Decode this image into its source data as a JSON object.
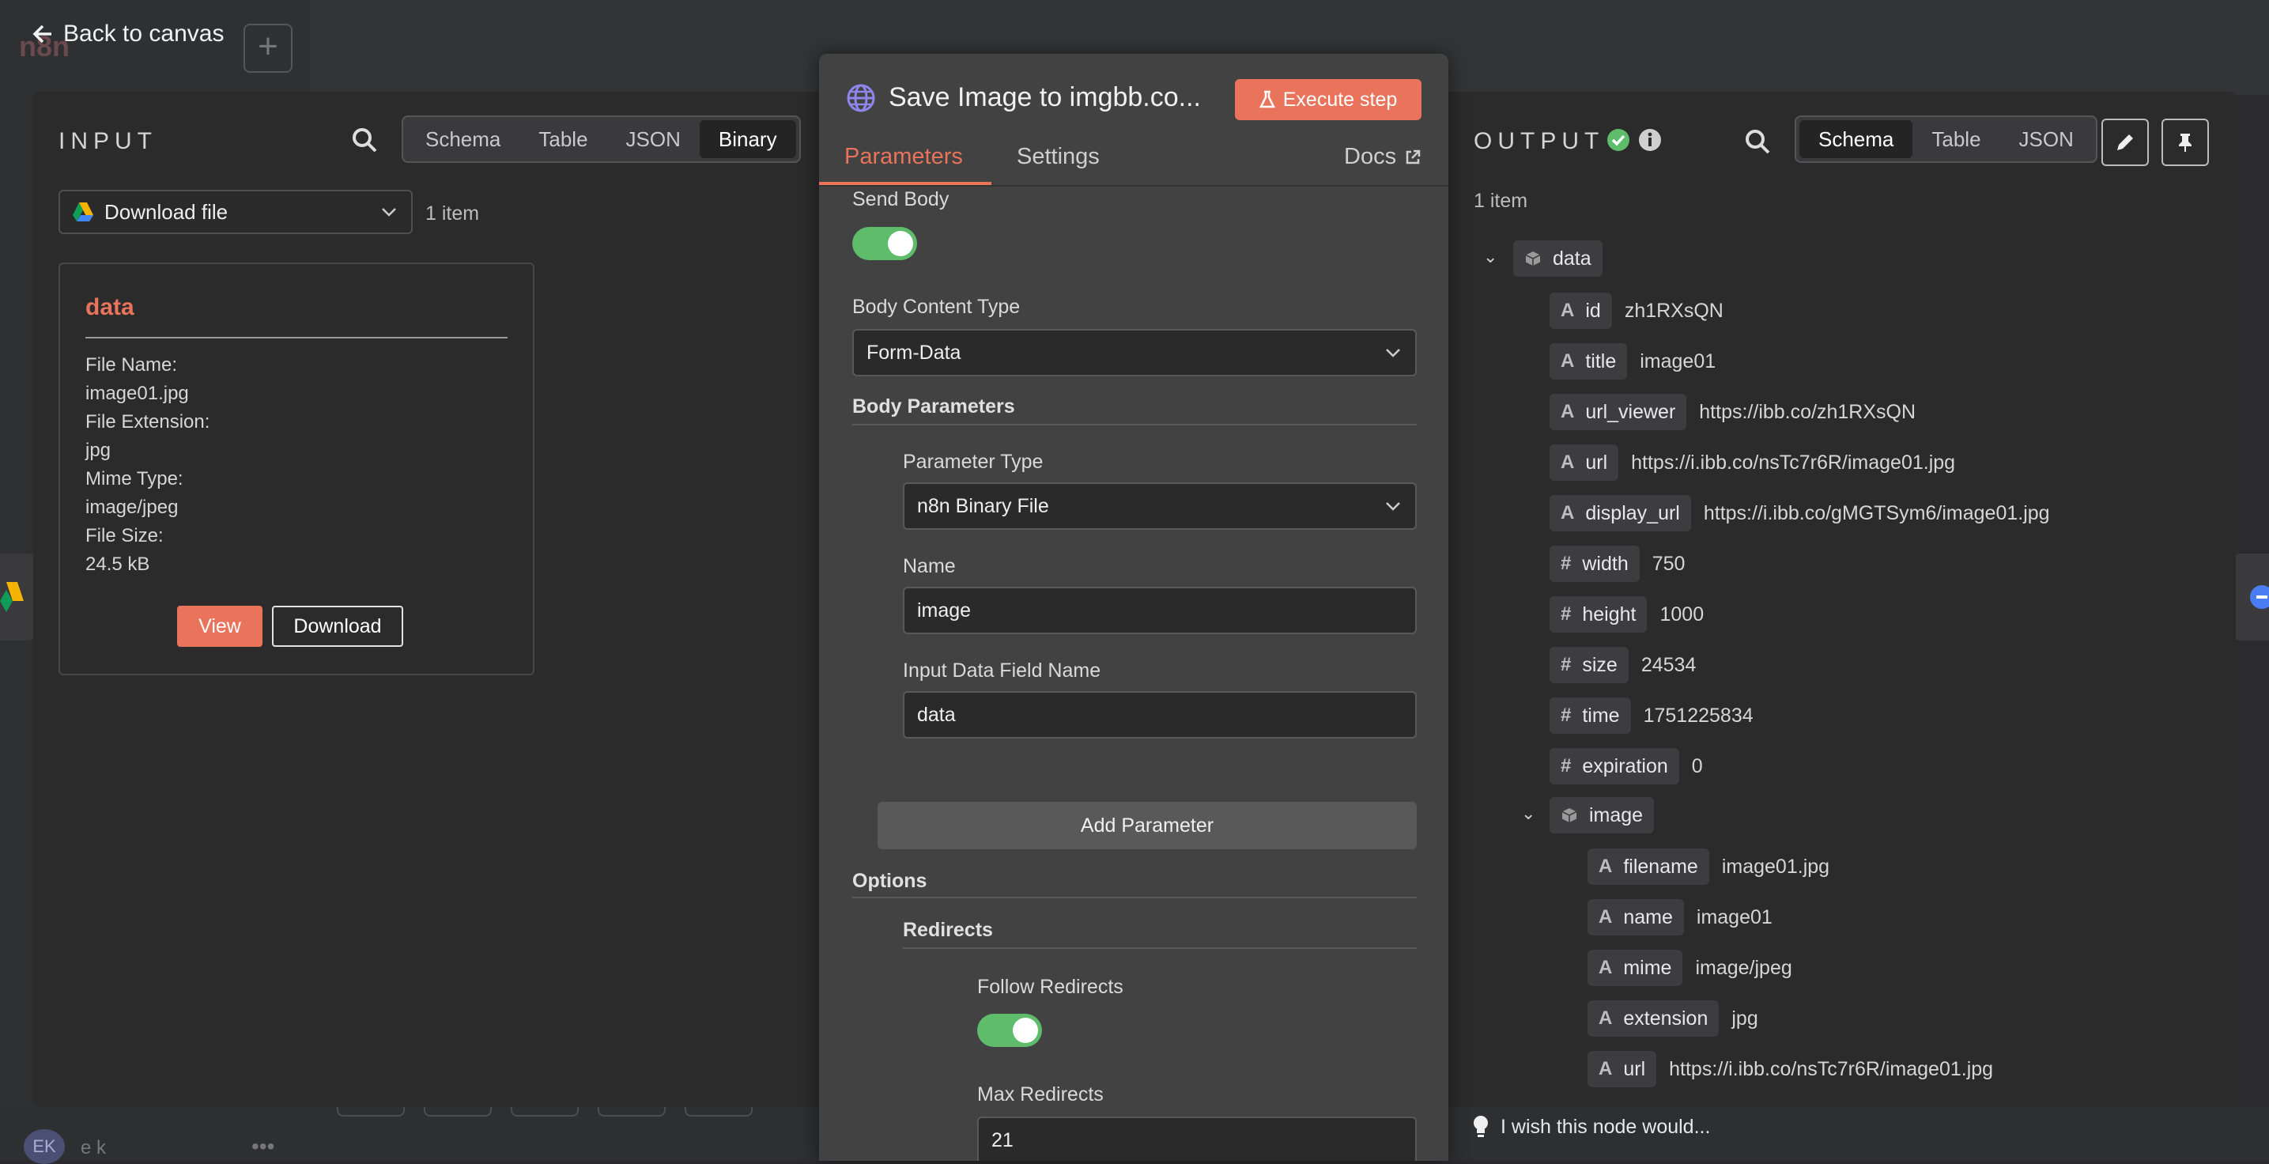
{
  "nav": {
    "back_label": "Back to canvas",
    "app_name": "n8n",
    "user_initials": "EK",
    "user_name": "e k"
  },
  "input": {
    "title": "INPUT",
    "tabs": [
      "Schema",
      "Table",
      "JSON",
      "Binary"
    ],
    "active_tab": "Binary",
    "node_select": "Download file",
    "item_count": "1 item",
    "card": {
      "title": "data",
      "lines": [
        "File Name:",
        "image01.jpg",
        "File Extension:",
        "jpg",
        "Mime Type:",
        "image/jpeg",
        "File Size:",
        "24.5 kB"
      ],
      "view_label": "View",
      "download_label": "Download"
    }
  },
  "node": {
    "title": "Save Image to imgbb.co...",
    "execute_label": "Execute step",
    "tabs": {
      "parameters": "Parameters",
      "settings": "Settings",
      "docs": "Docs"
    },
    "send_body_label": "Send Body",
    "send_body": true,
    "body_content_type_label": "Body Content Type",
    "body_content_type": "Form-Data",
    "body_parameters_label": "Body Parameters",
    "parameter_type_label": "Parameter Type",
    "parameter_type": "n8n Binary File",
    "name_label": "Name",
    "name_value": "image",
    "input_field_label": "Input Data Field Name",
    "input_field_value": "data",
    "add_parameter_label": "Add Parameter",
    "options_label": "Options",
    "redirects_label": "Redirects",
    "follow_redirects_label": "Follow Redirects",
    "follow_redirects": true,
    "max_redirects_label": "Max Redirects",
    "max_redirects_value": "21"
  },
  "output": {
    "title": "OUTPUT",
    "tabs": [
      "Schema",
      "Table",
      "JSON"
    ],
    "active_tab": "Schema",
    "item_count": "1 item",
    "data_label": "data",
    "fields": [
      {
        "type": "A",
        "key": "id",
        "value": "zh1RXsQN"
      },
      {
        "type": "A",
        "key": "title",
        "value": "image01"
      },
      {
        "type": "A",
        "key": "url_viewer",
        "value": "https://ibb.co/zh1RXsQN"
      },
      {
        "type": "A",
        "key": "url",
        "value": "https://i.ibb.co/nsTc7r6R/image01.jpg"
      },
      {
        "type": "A",
        "key": "display_url",
        "value": "https://i.ibb.co/gMGTSym6/image01.jpg"
      },
      {
        "type": "#",
        "key": "width",
        "value": "750"
      },
      {
        "type": "#",
        "key": "height",
        "value": "1000"
      },
      {
        "type": "#",
        "key": "size",
        "value": "24534"
      },
      {
        "type": "#",
        "key": "time",
        "value": "1751225834"
      },
      {
        "type": "#",
        "key": "expiration",
        "value": "0"
      }
    ],
    "image_label": "image",
    "image_fields": [
      {
        "type": "A",
        "key": "filename",
        "value": "image01.jpg"
      },
      {
        "type": "A",
        "key": "name",
        "value": "image01"
      },
      {
        "type": "A",
        "key": "mime",
        "value": "image/jpeg"
      },
      {
        "type": "A",
        "key": "extension",
        "value": "jpg"
      },
      {
        "type": "A",
        "key": "url",
        "value": "https://i.ibb.co/nsTc7r6R/image01.jpg"
      }
    ],
    "feedback": "I wish this node would..."
  },
  "colors": {
    "accent": "#e9735b",
    "success": "#5ebc6b",
    "panel": "#2b2b2b",
    "node_panel": "#424242"
  }
}
